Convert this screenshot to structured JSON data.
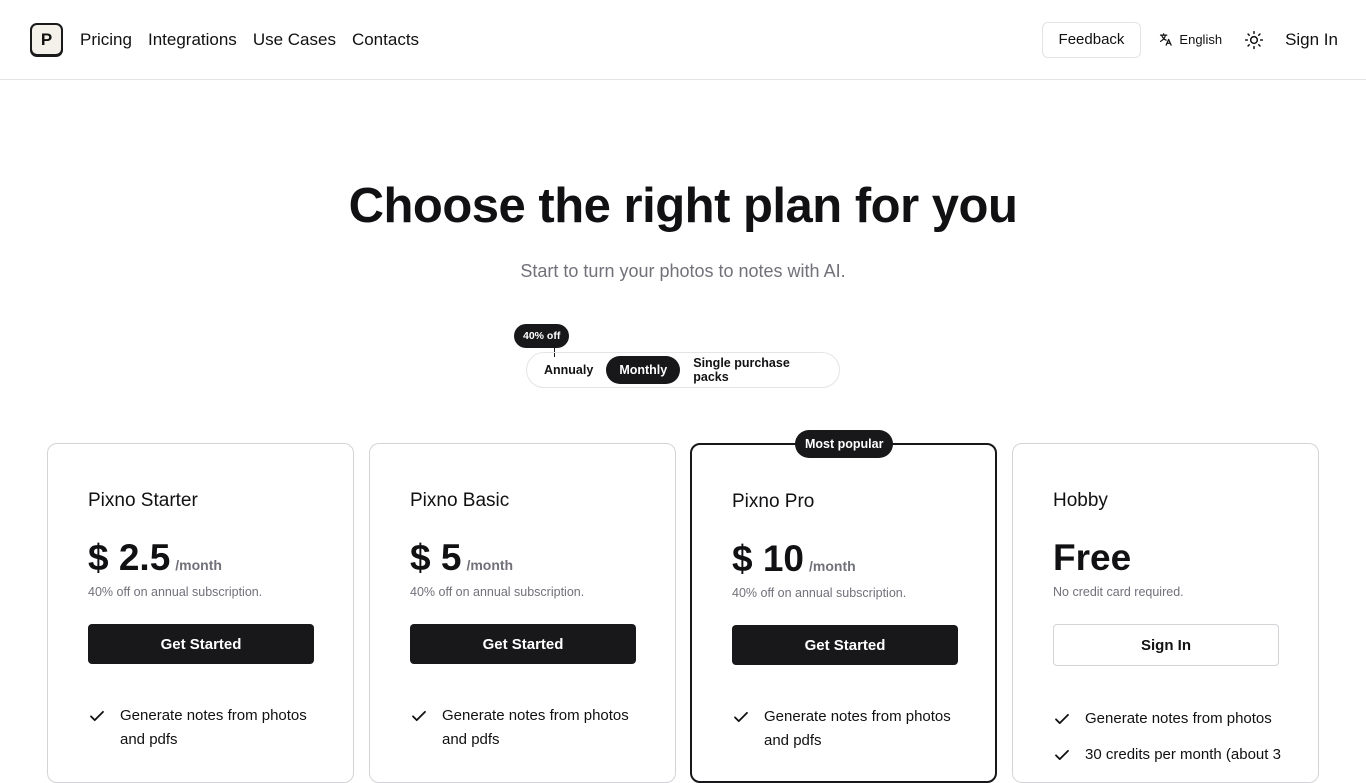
{
  "header": {
    "logo_letter": "P",
    "nav": [
      "Pricing",
      "Integrations",
      "Use Cases",
      "Contacts"
    ],
    "feedback_label": "Feedback",
    "language_label": "English",
    "signin_label": "Sign In"
  },
  "hero": {
    "title": "Choose the right plan for you",
    "subtitle": "Start to turn your photos to notes with AI."
  },
  "billing": {
    "discount_badge": "40% off",
    "options": [
      "Annualy",
      "Monthly",
      "Single purchase packs"
    ],
    "selected": "Monthly"
  },
  "plans": [
    {
      "name": "Pixno Starter",
      "price": "$ 2.5",
      "period": "/month",
      "note": "40% off on annual subscription.",
      "cta": "Get Started",
      "features": [
        "Generate notes from photos and pdfs"
      ]
    },
    {
      "name": "Pixno Basic",
      "price": "$ 5",
      "period": "/month",
      "note": "40% off on annual subscription.",
      "cta": "Get Started",
      "features": [
        "Generate notes from photos and pdfs"
      ]
    },
    {
      "name": "Pixno Pro",
      "badge": "Most popular",
      "price": "$ 10",
      "period": "/month",
      "note": "40% off on annual subscription.",
      "cta": "Get Started",
      "features": [
        "Generate notes from photos and pdfs"
      ]
    },
    {
      "name": "Hobby",
      "price": "Free",
      "period": "",
      "note": "No credit card required.",
      "cta": "Sign In",
      "features": [
        "Generate notes from photos",
        "30 credits per month (about 3"
      ]
    }
  ],
  "colors": {
    "primary": "#18181b",
    "muted": "#71717a",
    "border": "#e4e4e7"
  }
}
